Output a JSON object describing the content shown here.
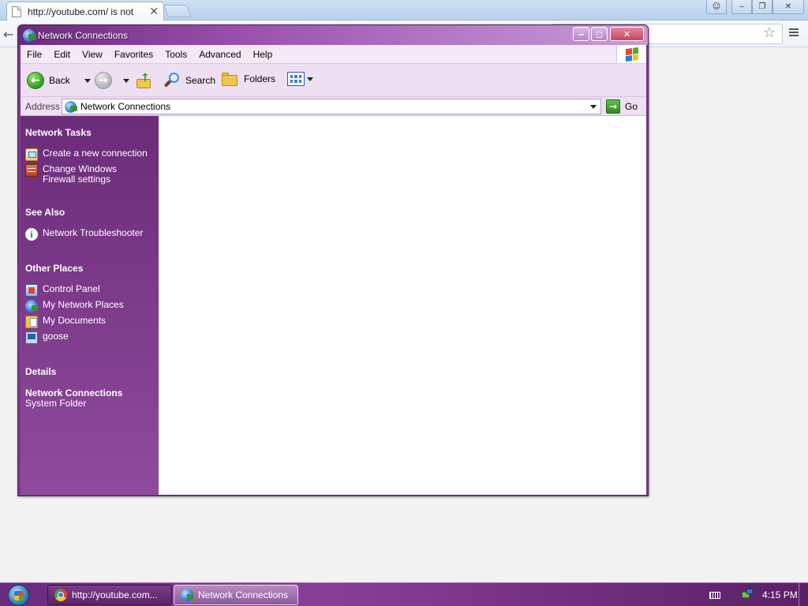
{
  "browser": {
    "tab_title": "http://youtube.com/ is not",
    "tab_close": "✕",
    "back_glyph": "←",
    "star_glyph": "☆"
  },
  "window": {
    "title": "Network Connections",
    "controls": {
      "minimize": "‒",
      "maximize": "◻",
      "close": "✕"
    }
  },
  "menu": [
    "File",
    "Edit",
    "View",
    "Favorites",
    "Tools",
    "Advanced",
    "Help"
  ],
  "toolbar": {
    "back_label": "Back",
    "search_label": "Search",
    "folders_label": "Folders"
  },
  "address": {
    "label": "Address",
    "value": "Network Connections",
    "go_label": "Go"
  },
  "task_pane": {
    "network_tasks": {
      "heading": "Network Tasks",
      "items": [
        {
          "label": "Create a new connection",
          "icon": "new-connection-icon"
        },
        {
          "label_line1": "Change Windows",
          "label_line2": "Firewall settings",
          "icon": "firewall-icon"
        }
      ]
    },
    "see_also": {
      "heading": "See Also",
      "items": [
        {
          "label": "Network Troubleshooter",
          "icon": "info-icon"
        }
      ]
    },
    "other_places": {
      "heading": "Other Places",
      "items": [
        {
          "label": "Control Panel",
          "icon": "control-panel-icon"
        },
        {
          "label": "My Network Places",
          "icon": "network-places-icon"
        },
        {
          "label": "My Documents",
          "icon": "documents-icon"
        },
        {
          "label": "goose",
          "icon": "computer-icon"
        }
      ]
    },
    "details": {
      "heading": "Details",
      "title": "Network Connections",
      "subtitle": "System Folder"
    }
  },
  "taskbar": {
    "buttons": [
      {
        "label": "http://youtube.com...",
        "icon": "chrome-icon",
        "active": false
      },
      {
        "label": "Network Connections",
        "icon": "network-connections-icon",
        "active": true
      }
    ],
    "clock": "4:15 PM"
  },
  "colors": {
    "theme_purple": "#7d3a8a",
    "task_pane_top": "#6b2c79",
    "task_pane_bottom": "#8f4a9c",
    "menu_bg": "#f3e8f6",
    "toolbar_bg": "#efdff3",
    "close_red": "#c4465f"
  }
}
